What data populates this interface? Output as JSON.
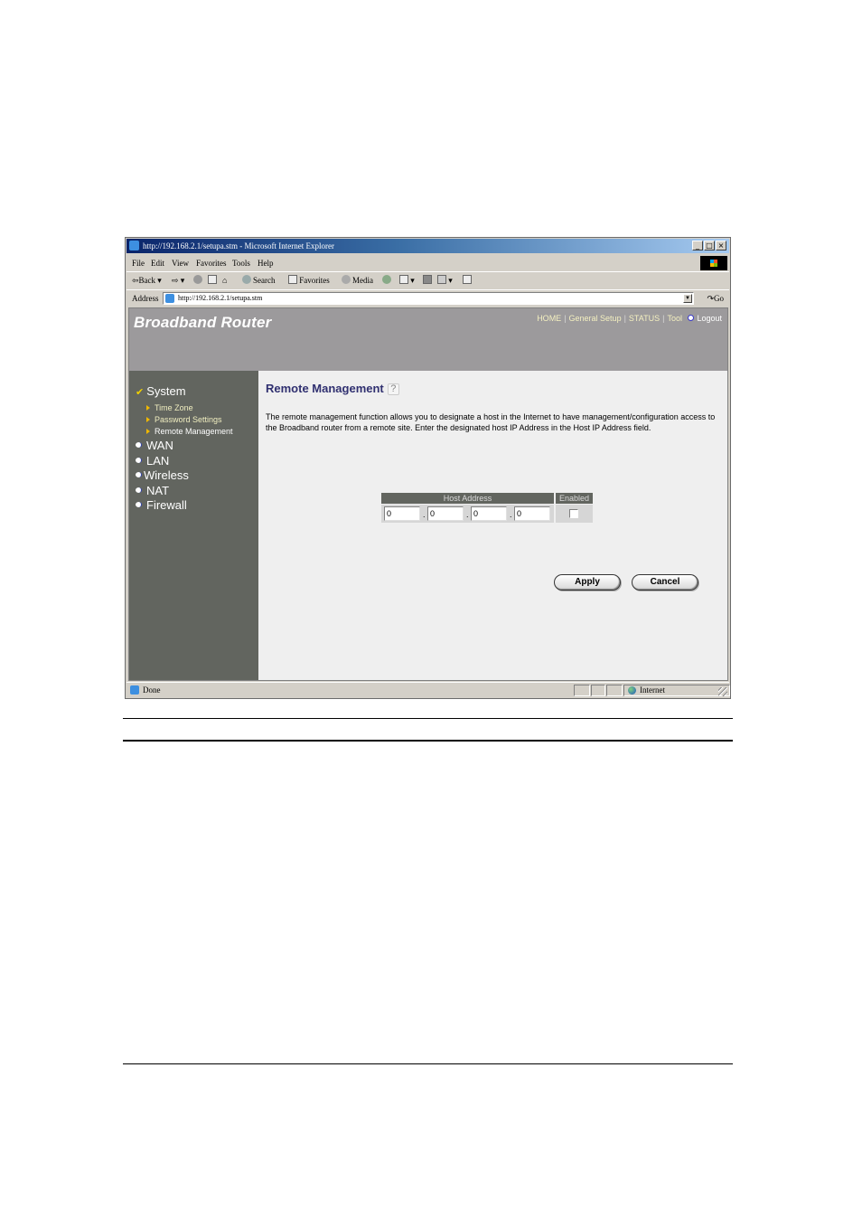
{
  "browser": {
    "title": "http://192.168.2.1/setupa.stm - Microsoft Internet Explorer",
    "window_buttons": [
      "_",
      "□",
      "×"
    ],
    "menu": [
      "File",
      "Edit",
      "View",
      "Favorites",
      "Tools",
      "Help"
    ],
    "toolbar": {
      "back": "⇦Back",
      "forward": "⇨",
      "search": "Search",
      "favorites": "Favorites",
      "media": "Media"
    },
    "address_label": "Address",
    "url": "http://192.168.2.1/setupa.stm",
    "go_label": "Go",
    "status_text": "Done",
    "zone_text": "Internet"
  },
  "header": {
    "brand": "Broadband Router",
    "nav": [
      "HOME",
      "General Setup",
      "STATUS",
      "Tool"
    ],
    "logout": "Logout"
  },
  "sidebar": {
    "system": "System",
    "sub_items": [
      "Time Zone",
      "Password Settings",
      "Remote Management"
    ],
    "items": [
      "WAN",
      "LAN",
      "Wireless",
      "NAT",
      "Firewall"
    ]
  },
  "main": {
    "title": "Remote Management",
    "help_icon": "?",
    "description": "The remote management function allows you to designate a host in the Internet to have management/configuration access to the Broadband router from a remote site. Enter the designated host IP Address in the Host IP Address field.",
    "host_address_header": "Host Address",
    "enabled_header": "Enabled",
    "ip_octets": [
      "0",
      "0",
      "0",
      "0"
    ],
    "ip_separator": ".",
    "enabled_checked": false,
    "apply_label": "Apply",
    "cancel_label": "Cancel"
  }
}
